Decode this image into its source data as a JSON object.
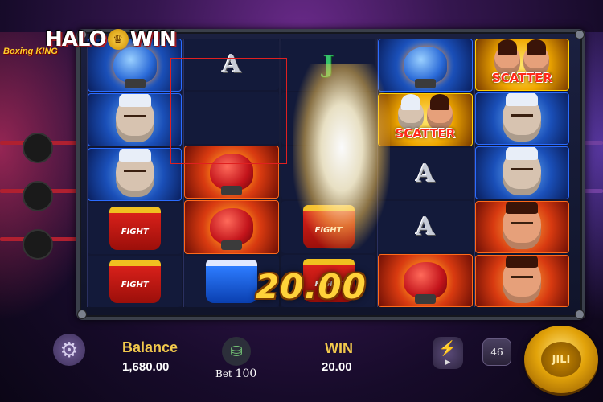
{
  "logo": {
    "left": "HALO",
    "right": "WIN"
  },
  "game_title": "Boxing KING",
  "reels": [
    [
      "blue-fist",
      "blue-old-fighter",
      "blue-old-fighter",
      "red-trunks",
      "red-trunks"
    ],
    [
      "letter-A",
      "blank",
      "red-glove",
      "red-glove",
      "blue-trunks"
    ],
    [
      "letter-J",
      "blast",
      "blast",
      "red-trunks",
      "red-trunks"
    ],
    [
      "blue-fist",
      "scatter",
      "letter-A",
      "letter-A",
      "red-glove"
    ],
    [
      "scatter",
      "blue-old-fighter",
      "blue-old-fighter",
      "red-fighter",
      "red-fighter"
    ]
  ],
  "symbols": {
    "letter_a": "A",
    "letter_j": "J",
    "scatter": "SCATTER",
    "trunks": "FIGHT"
  },
  "win_overlay": "20.00",
  "bottom": {
    "balance_label": "Balance",
    "balance_value": "1,680.00",
    "bet_label": "Bet",
    "bet_value": "100",
    "win_label": "WIN",
    "win_value": "20.00",
    "auto_count": "46",
    "spin_logo": "JILI"
  },
  "colors": {
    "accent_gold": "#f2c94c",
    "win_text": "#ffd23a",
    "scatter_red": "#ff2a1a"
  }
}
